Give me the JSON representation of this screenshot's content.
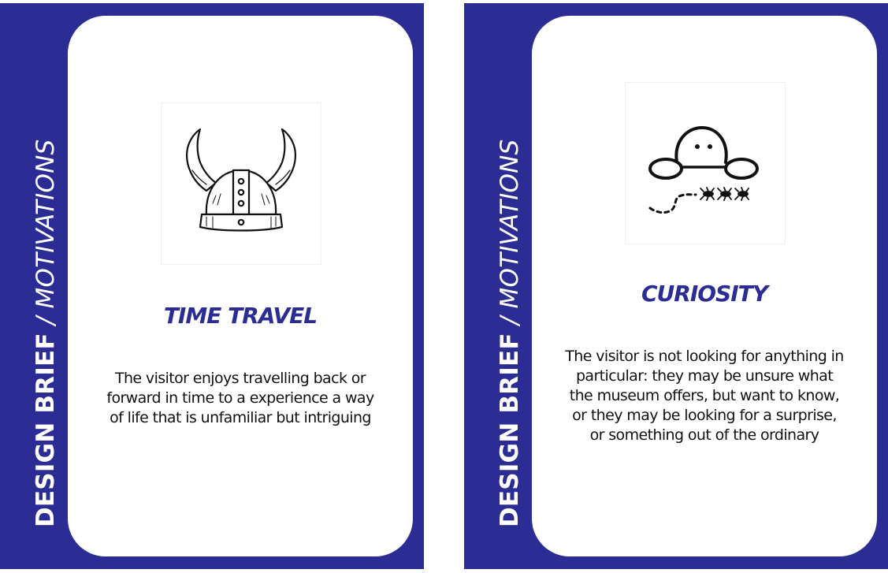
{
  "colors": {
    "card_bg": "#2b2d94",
    "panel_bg": "#ffffff",
    "title": "#2b2d94",
    "body_text": "#111111"
  },
  "cards": [
    {
      "side_label_bold": "DESIGN BRIEF",
      "side_label_sep": " / ",
      "side_label_light": "MOTIVATIONS",
      "icon": "viking-helmet-icon",
      "title": "TIME TRAVEL",
      "description": "The visitor enjoys travelling back or forward in time to a experience a way of life that is unfamiliar but intriguing"
    },
    {
      "side_label_bold": "DESIGN BRIEF",
      "side_label_sep": " / ",
      "side_label_light": "MOTIVATIONS",
      "icon": "peeking-face-ants-icon",
      "title": "CURIOSITY",
      "description": "The visitor is not looking for anything in particular: they may be unsure what the museum offers, but want to know, or they may be looking for a surprise, or something out of the ordinary"
    }
  ]
}
